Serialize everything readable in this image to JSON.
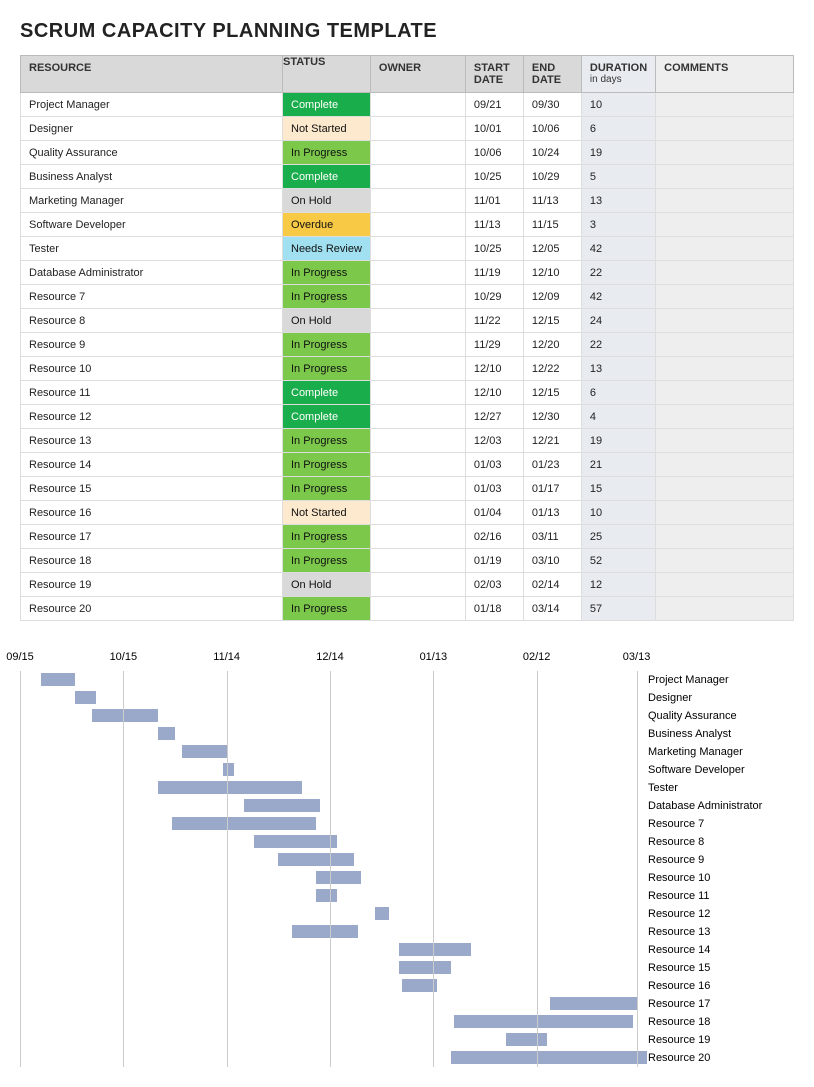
{
  "title": "SCRUM CAPACITY PLANNING TEMPLATE",
  "headers": {
    "resource": "RESOURCE",
    "status": "STATUS",
    "owner": "OWNER",
    "start": "START DATE",
    "end": "END DATE",
    "duration": "DURATION",
    "duration_sub": "in days",
    "comments": "COMMENTS"
  },
  "status_styles": {
    "Complete": "status-complete",
    "Not Started": "status-notstarted",
    "In Progress": "status-inprogress",
    "On Hold": "status-onhold",
    "Overdue": "status-overdue",
    "Needs Review": "status-needsreview"
  },
  "rows": [
    {
      "resource": "Project Manager",
      "status": "Complete",
      "owner": "",
      "start": "09/21",
      "end": "09/30",
      "duration": "10",
      "comments": ""
    },
    {
      "resource": "Designer",
      "status": "Not Started",
      "owner": "",
      "start": "10/01",
      "end": "10/06",
      "duration": "6",
      "comments": ""
    },
    {
      "resource": "Quality Assurance",
      "status": "In Progress",
      "owner": "",
      "start": "10/06",
      "end": "10/24",
      "duration": "19",
      "comments": ""
    },
    {
      "resource": "Business Analyst",
      "status": "Complete",
      "owner": "",
      "start": "10/25",
      "end": "10/29",
      "duration": "5",
      "comments": ""
    },
    {
      "resource": "Marketing Manager",
      "status": "On Hold",
      "owner": "",
      "start": "11/01",
      "end": "11/13",
      "duration": "13",
      "comments": ""
    },
    {
      "resource": "Software Developer",
      "status": "Overdue",
      "owner": "",
      "start": "11/13",
      "end": "11/15",
      "duration": "3",
      "comments": ""
    },
    {
      "resource": "Tester",
      "status": "Needs Review",
      "owner": "",
      "start": "10/25",
      "end": "12/05",
      "duration": "42",
      "comments": ""
    },
    {
      "resource": "Database Administrator",
      "status": "In Progress",
      "owner": "",
      "start": "11/19",
      "end": "12/10",
      "duration": "22",
      "comments": ""
    },
    {
      "resource": "Resource 7",
      "status": "In Progress",
      "owner": "",
      "start": "10/29",
      "end": "12/09",
      "duration": "42",
      "comments": ""
    },
    {
      "resource": "Resource 8",
      "status": "On Hold",
      "owner": "",
      "start": "11/22",
      "end": "12/15",
      "duration": "24",
      "comments": ""
    },
    {
      "resource": "Resource 9",
      "status": "In Progress",
      "owner": "",
      "start": "11/29",
      "end": "12/20",
      "duration": "22",
      "comments": ""
    },
    {
      "resource": "Resource 10",
      "status": "In Progress",
      "owner": "",
      "start": "12/10",
      "end": "12/22",
      "duration": "13",
      "comments": ""
    },
    {
      "resource": "Resource 11",
      "status": "Complete",
      "owner": "",
      "start": "12/10",
      "end": "12/15",
      "duration": "6",
      "comments": ""
    },
    {
      "resource": "Resource 12",
      "status": "Complete",
      "owner": "",
      "start": "12/27",
      "end": "12/30",
      "duration": "4",
      "comments": ""
    },
    {
      "resource": "Resource 13",
      "status": "In Progress",
      "owner": "",
      "start": "12/03",
      "end": "12/21",
      "duration": "19",
      "comments": ""
    },
    {
      "resource": "Resource 14",
      "status": "In Progress",
      "owner": "",
      "start": "01/03",
      "end": "01/23",
      "duration": "21",
      "comments": ""
    },
    {
      "resource": "Resource 15",
      "status": "In Progress",
      "owner": "",
      "start": "01/03",
      "end": "01/17",
      "duration": "15",
      "comments": ""
    },
    {
      "resource": "Resource 16",
      "status": "Not Started",
      "owner": "",
      "start": "01/04",
      "end": "01/13",
      "duration": "10",
      "comments": ""
    },
    {
      "resource": "Resource 17",
      "status": "In Progress",
      "owner": "",
      "start": "02/16",
      "end": "03/11",
      "duration": "25",
      "comments": ""
    },
    {
      "resource": "Resource 18",
      "status": "In Progress",
      "owner": "",
      "start": "01/19",
      "end": "03/10",
      "duration": "52",
      "comments": ""
    },
    {
      "resource": "Resource 19",
      "status": "On Hold",
      "owner": "",
      "start": "02/03",
      "end": "02/14",
      "duration": "12",
      "comments": ""
    },
    {
      "resource": "Resource 20",
      "status": "In Progress",
      "owner": "",
      "start": "01/18",
      "end": "03/14",
      "duration": "57",
      "comments": ""
    }
  ],
  "chart_data": {
    "type": "bar",
    "orientation": "horizontal-gantt",
    "x_axis_ticks": [
      "09/15",
      "10/15",
      "11/14",
      "12/14",
      "01/13",
      "02/12",
      "03/13"
    ],
    "x_range_days": [
      0,
      180
    ],
    "tick_day_offsets": [
      0,
      30,
      60,
      90,
      120,
      150,
      179
    ],
    "series": [
      {
        "name": "Project Manager",
        "start_offset_days": 6,
        "duration_days": 10
      },
      {
        "name": "Designer",
        "start_offset_days": 16,
        "duration_days": 6
      },
      {
        "name": "Quality Assurance",
        "start_offset_days": 21,
        "duration_days": 19
      },
      {
        "name": "Business Analyst",
        "start_offset_days": 40,
        "duration_days": 5
      },
      {
        "name": "Marketing Manager",
        "start_offset_days": 47,
        "duration_days": 13
      },
      {
        "name": "Software Developer",
        "start_offset_days": 59,
        "duration_days": 3
      },
      {
        "name": "Tester",
        "start_offset_days": 40,
        "duration_days": 42
      },
      {
        "name": "Database Administrator",
        "start_offset_days": 65,
        "duration_days": 22
      },
      {
        "name": "Resource 7",
        "start_offset_days": 44,
        "duration_days": 42
      },
      {
        "name": "Resource 8",
        "start_offset_days": 68,
        "duration_days": 24
      },
      {
        "name": "Resource 9",
        "start_offset_days": 75,
        "duration_days": 22
      },
      {
        "name": "Resource 10",
        "start_offset_days": 86,
        "duration_days": 13
      },
      {
        "name": "Resource 11",
        "start_offset_days": 86,
        "duration_days": 6
      },
      {
        "name": "Resource 12",
        "start_offset_days": 103,
        "duration_days": 4
      },
      {
        "name": "Resource 13",
        "start_offset_days": 79,
        "duration_days": 19
      },
      {
        "name": "Resource 14",
        "start_offset_days": 110,
        "duration_days": 21
      },
      {
        "name": "Resource 15",
        "start_offset_days": 110,
        "duration_days": 15
      },
      {
        "name": "Resource 16",
        "start_offset_days": 111,
        "duration_days": 10
      },
      {
        "name": "Resource 17",
        "start_offset_days": 154,
        "duration_days": 25
      },
      {
        "name": "Resource 18",
        "start_offset_days": 126,
        "duration_days": 52
      },
      {
        "name": "Resource 19",
        "start_offset_days": 141,
        "duration_days": 12
      },
      {
        "name": "Resource 20",
        "start_offset_days": 125,
        "duration_days": 57
      }
    ]
  }
}
